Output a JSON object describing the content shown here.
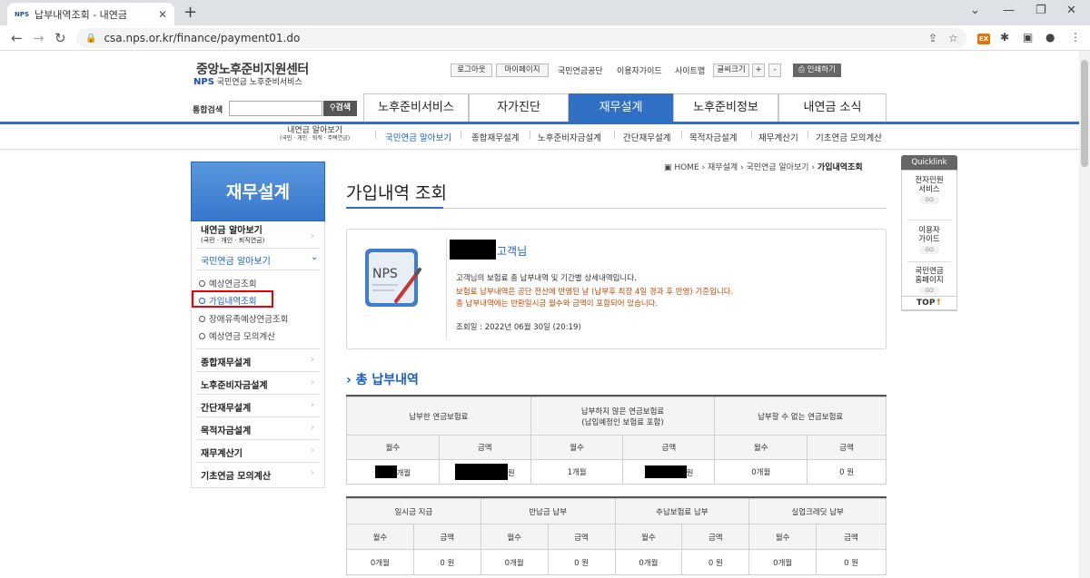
{
  "browser": {
    "tab_title": "납부내역조회 - 내연금",
    "favicon_text": "NPS",
    "url": "csa.nps.or.kr/finance/payment01.do"
  },
  "site": {
    "logo_main": "중앙노후준비지원센터",
    "logo_nps": "NPS",
    "logo_sub": "국민연금 노후준비서비스",
    "top_links": {
      "logout": "로그아웃",
      "mypage": "마이페이지",
      "nps": "국민연금공단",
      "guide": "이용자가이드",
      "sitemap": "사이트맵",
      "fontsize": "글씨크기",
      "plus": "+",
      "minus": "-",
      "print": "인쇄하기"
    },
    "search_label": "통합검색",
    "search_button": "검색",
    "gnb": [
      "노후준비서비스",
      "자가진단",
      "재무설계",
      "노후준비정보",
      "내연금 소식"
    ],
    "subnav": {
      "first_line1": "내연금 알아보기",
      "first_line2": "(국민 · 개인 · 퇴직 · 주택연금)",
      "items": [
        "국민연금 알아보기",
        "종합재무설계",
        "노후준비자금설계",
        "간단재무설계",
        "목적자금설계",
        "재무계산기",
        "기초연금 모의계산"
      ]
    }
  },
  "lnb": {
    "title": "재무설계",
    "item1_line1": "내연금 알아보기",
    "item1_line2": "(국민 · 개인 · 퇴직연금)",
    "item2": "국민연금 알아보기",
    "subs": [
      "예상연금조회",
      "가입내역조회",
      "장애유족예상연금조회",
      "예상연금 모의계산"
    ],
    "items": [
      "종합재무설계",
      "노후준비자금설계",
      "간단재무설계",
      "목적자금설계",
      "재무계산기",
      "기초연금 모의계산"
    ]
  },
  "content": {
    "breadcrumb": [
      "HOME",
      "재무설계",
      "국민연금 알아보기",
      "가입내역조회"
    ],
    "page_title": "가입내역 조회",
    "nps_icon_text": "NPS",
    "customer_suffix": "고객님",
    "info1": "고객님의 보험료 총 납부내역 및 기간별 상세내역입니다.",
    "info2": "보험료 납부내역은 공단 전산에 반영된 날 (납부후 최장 4일 경과 후 반영) 기준입니다.",
    "info3": "총 납부내역에는 반환일시금 월수와 금액이 포함되어 있습니다.",
    "query_date": "조회일 : 2022년 06월 30일 (20:19)",
    "section_title": "총 납부내역",
    "table1": {
      "groups": [
        "납부한 연금보험료",
        "납부하지 않은 연금보험료",
        "(납입예정인 보험료 포함)",
        "납부할 수 없는 연금보험료"
      ],
      "cols": [
        "월수",
        "금액",
        "월수",
        "금액",
        "월수",
        "금액"
      ],
      "row": [
        "개월",
        "원",
        "1개월",
        "원",
        "0개월",
        "0 원"
      ]
    },
    "table2": {
      "groups": [
        "일시금 지급",
        "반납금 납부",
        "추납보험료 납부",
        "실업크레딧 납부"
      ],
      "cols": [
        "월수",
        "금액",
        "월수",
        "금액",
        "월수",
        "금액",
        "월수",
        "금액"
      ],
      "row": [
        "0개월",
        "0 원",
        "0개월",
        "0 원",
        "0개월",
        "0 원",
        "0개월",
        "0 원"
      ]
    }
  },
  "quicklink": {
    "header": "Quicklink",
    "items": [
      {
        "l1": "전자민원",
        "l2": "서비스",
        "go": "GO"
      },
      {
        "l1": "이용자",
        "l2": "가이드",
        "go": "GO"
      },
      {
        "l1": "국민연금",
        "l2": "홈페이지",
        "go": "GO"
      }
    ],
    "top": "TOP",
    "top_arrow": "↑"
  },
  "colors": {
    "brand_blue": "#2f6fc4",
    "orange_text": "#c04a00",
    "highlight_red": "#e00000"
  }
}
